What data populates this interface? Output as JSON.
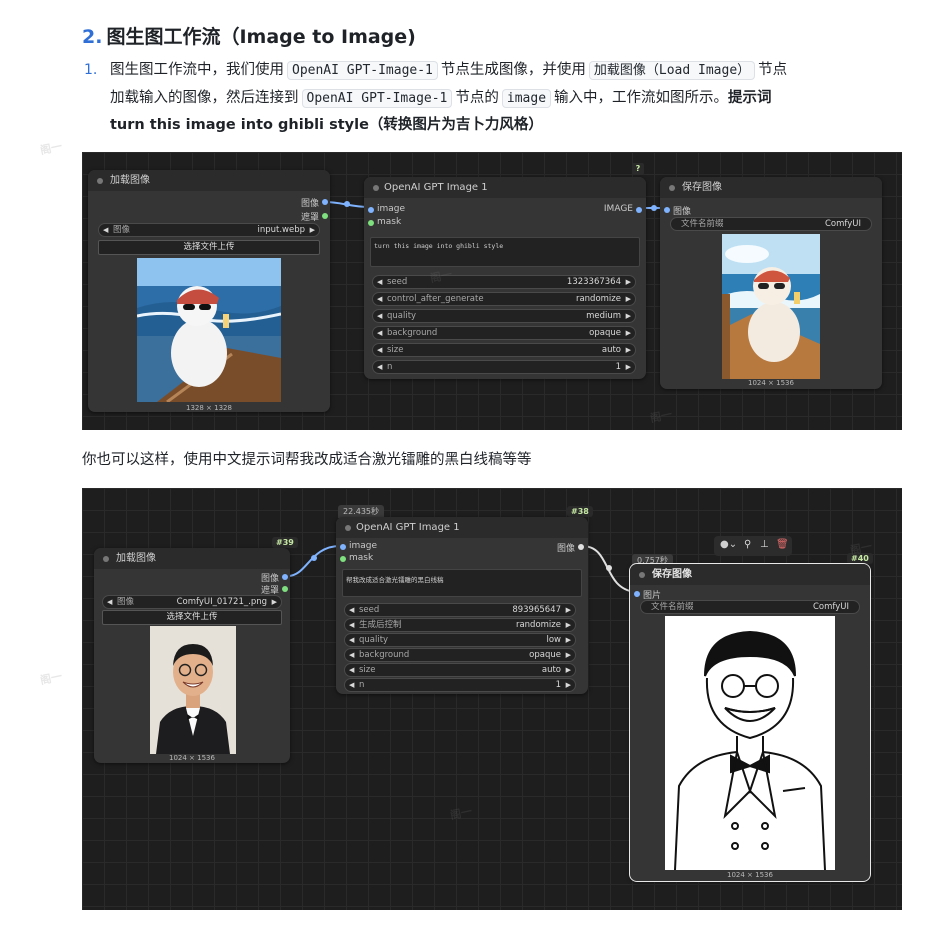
{
  "heading": {
    "num": "2.",
    "text": "图生图工作流（Image to Image)"
  },
  "list_item": {
    "num": "1.",
    "l1_a": "图生图工作流中，我们使用",
    "l1_code1": "OpenAI GPT-Image-1",
    "l1_b": "节点生成图像，并使用",
    "l1_code2": "加载图像（Load Image）",
    "l1_c": "节点",
    "l2_a": "加载输入的图像，然后连接到",
    "l2_code1": "OpenAI GPT-Image-1",
    "l2_b": "节点的",
    "l2_code2": "image",
    "l2_c": "输入中，工作流如图所示。",
    "l2_bold": "提示词",
    "l3_bold": "turn this image into ghibli style（转换图片为吉卜力风格）"
  },
  "paragraph2": "你也可以这样，使用中文提示词帮我改成适合激光镭雕的黑白线稿等等",
  "workflow1": {
    "load": {
      "title": "加载图像",
      "out_image": "图像",
      "out_mask": "遮罩",
      "widget_label": "图像",
      "widget_value": "input.webp",
      "upload": "选择文件上传",
      "size": "1328 × 1328"
    },
    "gpt": {
      "title": "OpenAI GPT Image 1",
      "in_image": "image",
      "in_mask": "mask",
      "out_image": "IMAGE",
      "prompt": "turn this image into ghibli style",
      "widgets": [
        {
          "label": "seed",
          "value": "1323367364"
        },
        {
          "label": "control_after_generate",
          "value": "randomize"
        },
        {
          "label": "quality",
          "value": "medium"
        },
        {
          "label": "background",
          "value": "opaque"
        },
        {
          "label": "size",
          "value": "auto"
        },
        {
          "label": "n",
          "value": "1"
        }
      ],
      "help": "?"
    },
    "save": {
      "title": "保存图像",
      "in_image": "图像",
      "widget_label": "文件名前缀",
      "widget_value": "ComfyUI",
      "size": "1024 × 1536"
    }
  },
  "workflow2": {
    "load": {
      "badge": "#39",
      "title": "加载图像",
      "out_image": "图像",
      "out_mask": "遮罩",
      "widget_label": "图像",
      "widget_value": "ComfyUI_01721_.png",
      "upload": "选择文件上传",
      "size": "1024 × 1536"
    },
    "gpt": {
      "timer": "22.435秒",
      "badge": "#38",
      "title": "OpenAI GPT Image 1",
      "in_image": "image",
      "in_mask": "mask",
      "out_image": "图像",
      "prompt": "帮我改成适合激光镭雕的黑白线稿",
      "widgets": [
        {
          "label": "seed",
          "value": "893965647"
        },
        {
          "label": "生成后控制",
          "value": "randomize"
        },
        {
          "label": "quality",
          "value": "low"
        },
        {
          "label": "background",
          "value": "opaque"
        },
        {
          "label": "size",
          "value": "auto"
        },
        {
          "label": "n",
          "value": "1"
        }
      ]
    },
    "save": {
      "timer": "0.757秒",
      "badge": "#40",
      "title": "保存图像",
      "in_image": "图片",
      "widget_label": "文件名前缀",
      "widget_value": "ComfyUI",
      "size": "1024 × 1536"
    }
  },
  "colors": {
    "accent": "#2f6fd6",
    "canvas": "#1e1e1e",
    "node": "#353535",
    "link_blue": "#7fb3ff",
    "link_white": "#e0e0e0",
    "badge": "#c6e9a4"
  }
}
